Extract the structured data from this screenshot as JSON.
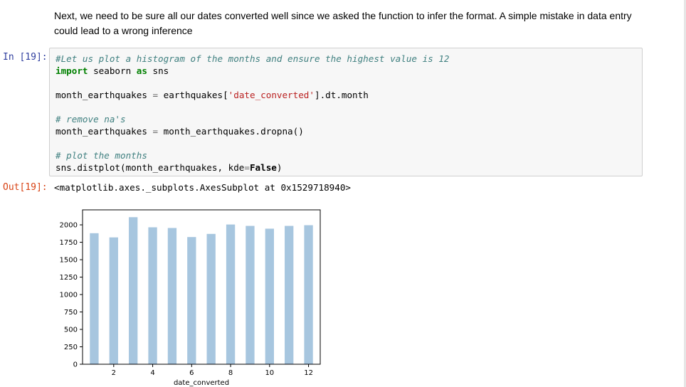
{
  "markdown": {
    "text": "Next, we need to be sure all our dates converted well since we asked the function to infer the format. A simple mistake in data entry could lead to a wrong inference"
  },
  "cell_in": {
    "prompt": "In [19]:",
    "lines": {
      "l1_comment": "#Let us plot a histogram of the months and ensure the highest value is 12",
      "l2_kw_import": "import",
      "l2_mod": " seaborn ",
      "l2_kw_as": "as",
      "l2_alias": " sns",
      "l4_var": "month_earthquakes ",
      "l4_eq": "=",
      "l4_obj": " earthquakes[",
      "l4_str": "'date_converted'",
      "l4_rest": "].dt.month",
      "l6_comment": "# remove na's",
      "l7_var": "month_earthquakes ",
      "l7_eq": "=",
      "l7_rest": " month_earthquakes.dropna()",
      "l9_comment": "# plot the months",
      "l10_call": "sns.distplot(month_earthquakes, kde",
      "l10_eq": "=",
      "l10_false": "False",
      "l10_close": ")"
    }
  },
  "cell_out": {
    "prompt": "Out[19]:",
    "text": "<matplotlib.axes._subplots.AxesSubplot at 0x1529718940>"
  },
  "colors": {
    "bar": "#a7c6df",
    "in_prompt": "#303f9f",
    "out_prompt": "#d84315"
  },
  "chart_data": {
    "type": "bar",
    "title": "",
    "xlabel": "date_converted",
    "ylabel": "",
    "x": [
      1,
      2,
      3,
      4,
      5,
      6,
      7,
      8,
      9,
      10,
      11,
      12
    ],
    "values": [
      1880,
      1820,
      2110,
      1965,
      1955,
      1825,
      1870,
      2005,
      1985,
      1945,
      1985,
      1995
    ],
    "xlim": [
      0.4,
      12.6
    ],
    "ylim": [
      0,
      2215
    ],
    "xticks": [
      2,
      4,
      6,
      8,
      10,
      12
    ],
    "yticks": [
      0,
      250,
      500,
      750,
      1000,
      1250,
      1500,
      1750,
      2000
    ],
    "grid": false
  }
}
